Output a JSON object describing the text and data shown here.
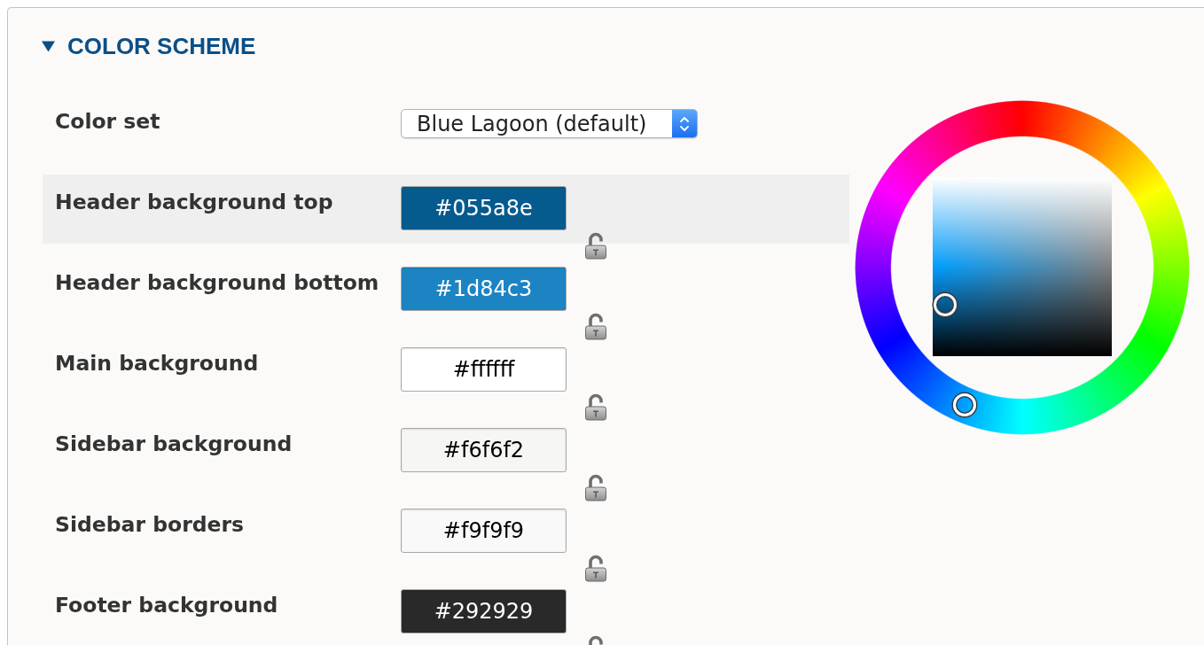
{
  "section": {
    "title": "COLOR SCHEME",
    "expanded": true
  },
  "color_set": {
    "label": "Color set",
    "value": "Blue Lagoon (default)"
  },
  "rows": [
    {
      "label": "Header background top",
      "value": "#055a8e",
      "color": "#055a8e",
      "selected": true,
      "locked": false
    },
    {
      "label": "Header background bottom",
      "value": "#1d84c3",
      "color": "#1d84c3",
      "selected": false,
      "locked": false
    },
    {
      "label": "Main background",
      "value": "#ffffff",
      "color": "#ffffff",
      "selected": false,
      "locked": false
    },
    {
      "label": "Sidebar background",
      "value": "#f6f6f2",
      "color": "#f6f6f2",
      "selected": false,
      "locked": false
    },
    {
      "label": "Sidebar borders",
      "value": "#f9f9f9",
      "color": "#f9f9f9",
      "selected": false,
      "locked": false
    },
    {
      "label": "Footer background",
      "value": "#292929",
      "color": "#292929",
      "selected": false,
      "locked": false
    }
  ]
}
